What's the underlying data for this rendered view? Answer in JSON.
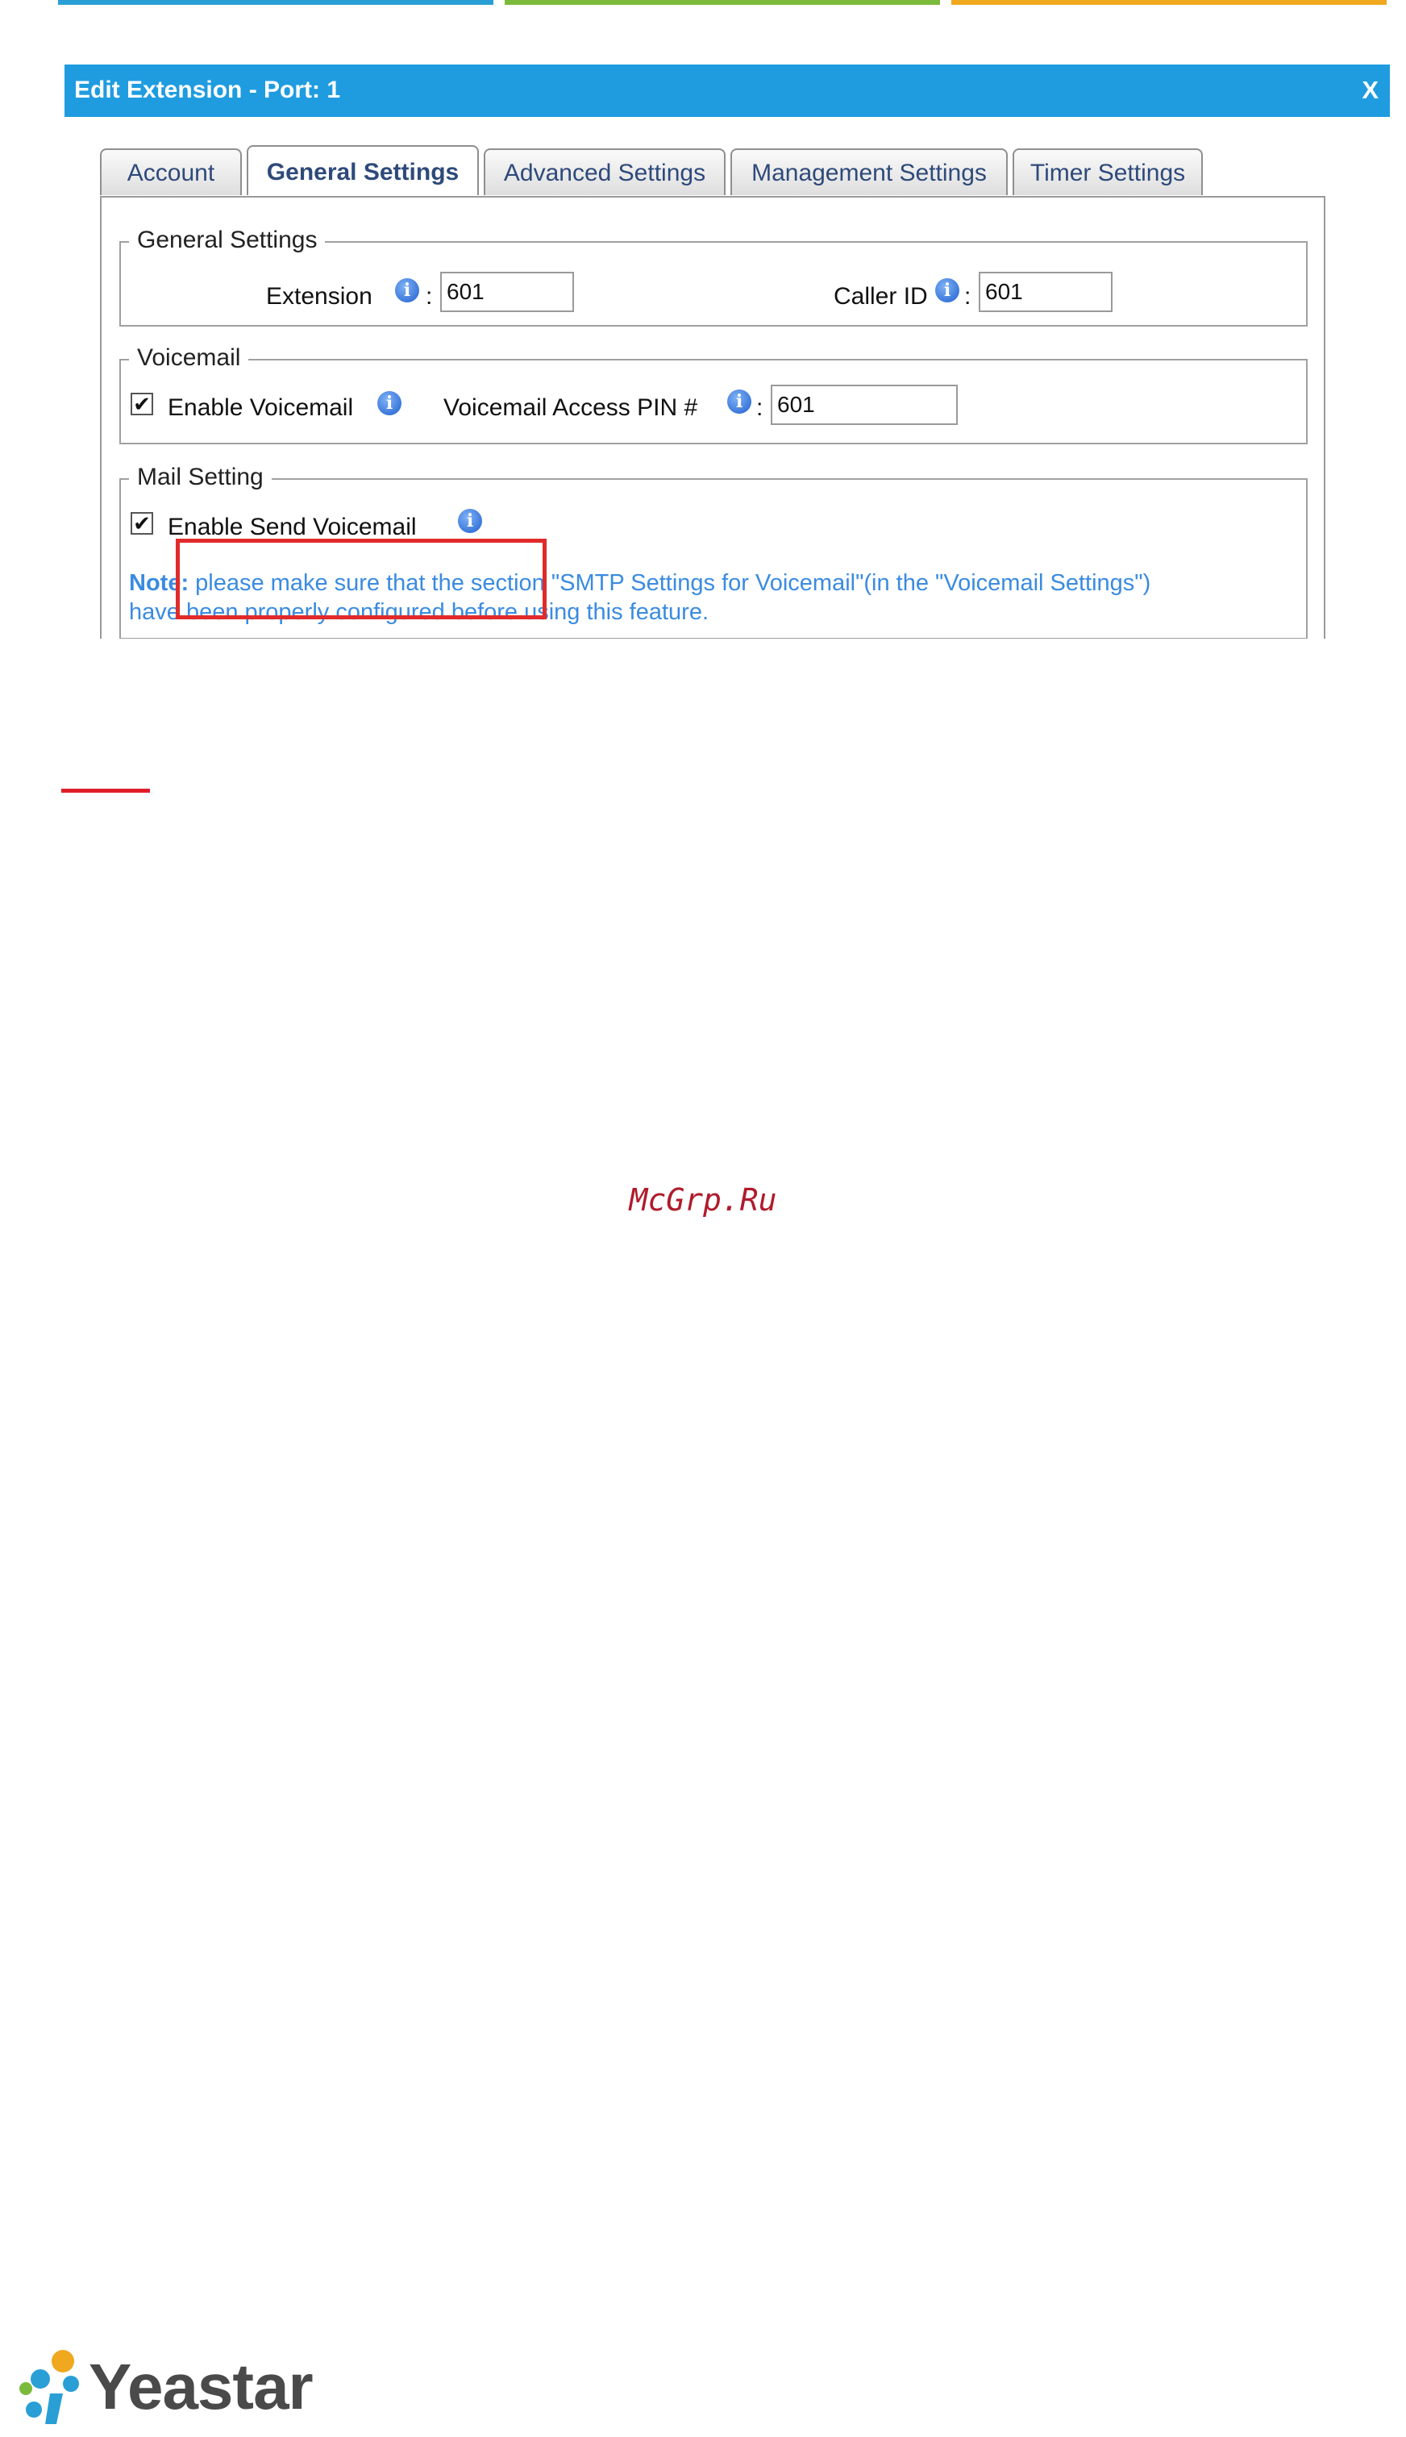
{
  "dialog": {
    "title": "Edit Extension - Port: 1",
    "close_label": "X"
  },
  "tabs": [
    {
      "label": "Account",
      "active": false
    },
    {
      "label": "General Settings",
      "active": true
    },
    {
      "label": "Advanced Settings",
      "active": false
    },
    {
      "label": "Management Settings",
      "active": false
    },
    {
      "label": "Timer Settings",
      "active": false
    }
  ],
  "general_settings": {
    "legend": "General Settings",
    "extension_label": "Extension",
    "extension_value": "601",
    "caller_id_label": "Caller ID",
    "caller_id_value": "601",
    "colon": ":"
  },
  "voicemail": {
    "legend": "Voicemail",
    "enable_label": "Enable Voicemail",
    "enable_checked": true,
    "pin_label": "Voicemail Access PIN #",
    "pin_value": "601",
    "colon": ":"
  },
  "mail_setting": {
    "legend": "Mail Setting",
    "enable_send_label": "Enable Send Voicemail",
    "enable_send_checked": true,
    "note_prefix": "Note:",
    "note_text": " please make sure that the section \"SMTP Settings for Voicemail\"(in the \"Voicemail Settings\") have been properly configured before using this feature."
  },
  "checkmark": "✔",
  "info_glyph": "i",
  "watermark": "McGrp.Ru",
  "logo_text": "Yeastar",
  "colors": {
    "titlebar": "#1f9ce0",
    "highlight_box": "#e12b2b",
    "note_text": "#3a8be0",
    "top_bar_blue": "#2a9fd6",
    "top_bar_green": "#7cba3b",
    "top_bar_orange": "#f0a81e"
  }
}
